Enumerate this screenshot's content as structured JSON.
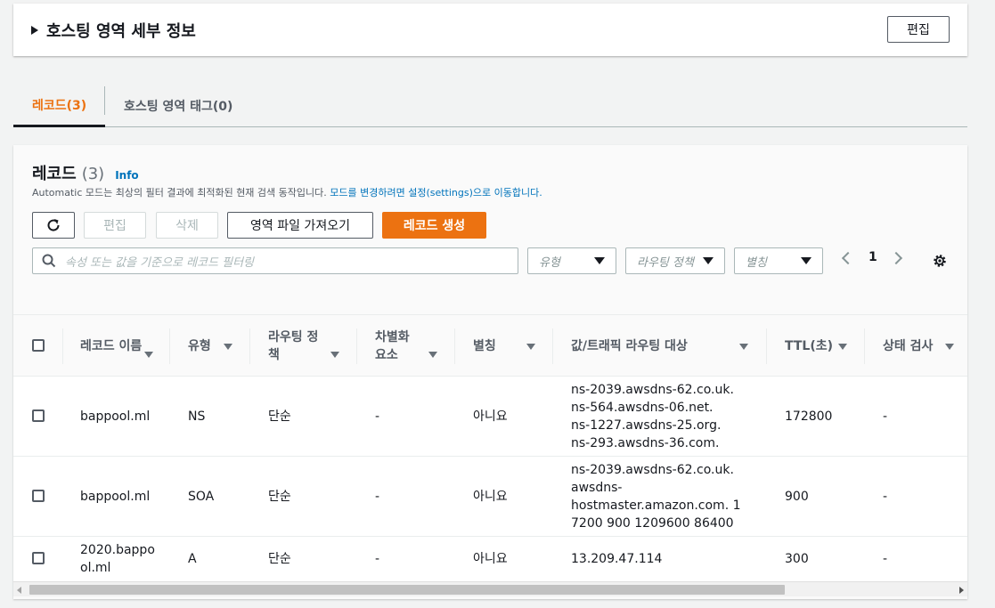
{
  "hosted_zone": {
    "title": "호스팅 영역 세부 정보",
    "edit_label": "편집"
  },
  "tabs": [
    {
      "label": "레코드(3)",
      "active": true
    },
    {
      "label": "호스팅 영역 태그(0)",
      "active": false
    }
  ],
  "records": {
    "title": "레코드",
    "count": "(3)",
    "info": "Info",
    "desc_text": "Automatic 모드는 최상의 필터 결과에 최적화된 현재 검색 동작입니다. ",
    "desc_link": "모드를 변경하려면 설정(settings)으로 이동합니다.",
    "buttons": {
      "edit": "편집",
      "delete": "삭제",
      "import": "영역 파일 가져오기",
      "create": "레코드 생성"
    },
    "search_placeholder": "속성 또는 값을 기준으로 레코드 필터링",
    "filters": {
      "type": "유형",
      "routing": "라우팅 정책",
      "alias": "별칭"
    },
    "page": "1"
  },
  "columns": {
    "name": "레코드 이름",
    "type": "유형",
    "routing": "라우팅 정책",
    "diff": "차별화 요소",
    "alias": "별칭",
    "value": "값/트래픽 라우팅 대상",
    "ttl": "TTL(초)",
    "health": "상태 검사"
  },
  "rows": [
    {
      "name": "bappool.ml",
      "type": "NS",
      "routing": "단순",
      "diff": "-",
      "alias": "아니요",
      "value": [
        "ns-2039.awsdns-62.co.uk.",
        "ns-564.awsdns-06.net.",
        "ns-1227.awsdns-25.org.",
        "ns-293.awsdns-36.com."
      ],
      "ttl": "172800",
      "health": "-"
    },
    {
      "name": "bappool.ml",
      "type": "SOA",
      "routing": "단순",
      "diff": "-",
      "alias": "아니요",
      "value": [
        "ns-2039.awsdns-62.co.uk.",
        "awsdns-",
        "hostmaster.amazon.com. 1",
        "7200 900 1209600 86400"
      ],
      "ttl": "900",
      "health": "-"
    },
    {
      "name_lines": [
        "2020.bappo",
        "ol.ml"
      ],
      "type": "A",
      "routing": "단순",
      "diff": "-",
      "alias": "아니요",
      "value": [
        "13.209.47.114"
      ],
      "ttl": "300",
      "health": "-"
    }
  ],
  "colors": {
    "accent": "#ec7211",
    "link": "#0073bb"
  }
}
